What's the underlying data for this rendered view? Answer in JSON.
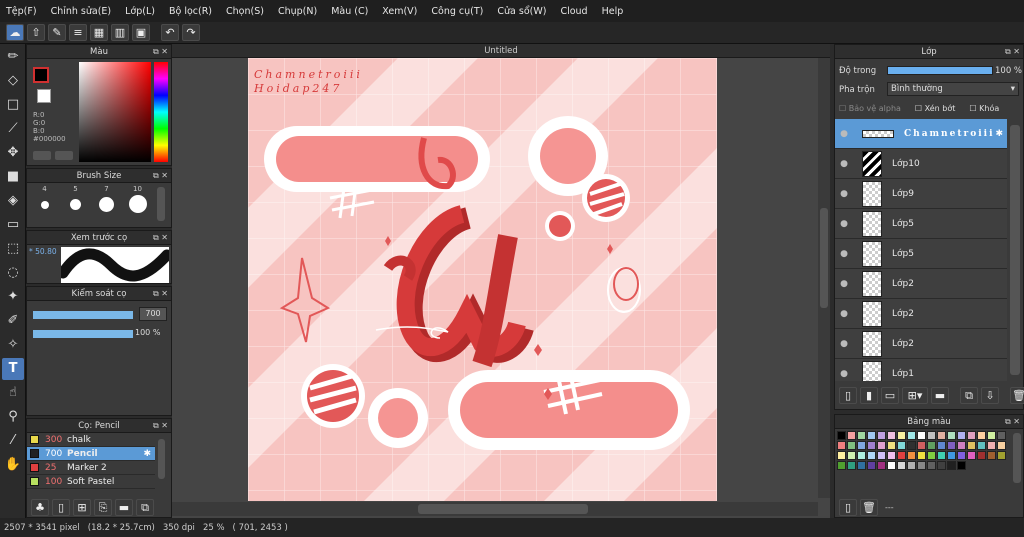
{
  "menu": [
    "Tệp(F)",
    "Chỉnh sửa(E)",
    "Lớp(L)",
    "Bộ lọc(R)",
    "Chọn(S)",
    "Chụp(N)",
    "Màu (C)",
    "Xem(V)",
    "Công cụ(T)",
    "Cửa sổ(W)",
    "Cloud",
    "Help"
  ],
  "document": {
    "title": "Untitled"
  },
  "color_panel": {
    "title": "Màu",
    "r": "R:0",
    "g": "G:0",
    "b": "B:0",
    "hex": "#000000"
  },
  "brush_size_panel": {
    "title": "Brush Size",
    "sizes": [
      "4",
      "5",
      "7",
      "10"
    ]
  },
  "preview_panel": {
    "title": "Xem trước cọ",
    "value": "50.80"
  },
  "control_panel": {
    "title": "Kiểm soát cọ",
    "size_value": "700",
    "opacity_value": "100 %",
    "size_fill": 1.0,
    "opacity_fill": 1.0
  },
  "brush_panel": {
    "title": "Cọ: Pencil",
    "items": [
      {
        "size": "300",
        "name": "chalk",
        "color": "#e8d84a"
      },
      {
        "size": "700",
        "name": "Pencil",
        "color": "#222222",
        "selected": true
      },
      {
        "size": "25",
        "name": "Marker 2",
        "color": "#e04040"
      },
      {
        "size": "100",
        "name": "Soft Pastel",
        "color": "#b8e060"
      }
    ]
  },
  "layer_panel": {
    "title": "Lớp",
    "opacity_label": "Độ trong",
    "opacity_value": "100 %",
    "blend_label": "Pha trộn",
    "blend_value": "Bình thường",
    "protect_alpha": "Bảo vệ alpha",
    "clipping": "Xén bớt",
    "lock": "Khóa",
    "layers": [
      {
        "name": "Chamnetroiii",
        "selected": true
      },
      {
        "name": "Lớp10"
      },
      {
        "name": "Lớp9"
      },
      {
        "name": "Lớp5"
      },
      {
        "name": "Lớp5"
      },
      {
        "name": "Lớp2"
      },
      {
        "name": "Lớp2"
      },
      {
        "name": "Lớp2"
      },
      {
        "name": "Lớp1"
      }
    ]
  },
  "palette_panel": {
    "title": "Bảng màu",
    "footer": "---"
  },
  "artwork": {
    "watermark_line1": "Chamnetroiii",
    "watermark_line2": "Hoidap247"
  },
  "status": {
    "size": "2507 * 3541 pixel",
    "cm": "(18.2 * 25.7cm)",
    "dpi": "350 dpi",
    "zoom": "25 %",
    "coords": "( 701, 2453 )"
  },
  "colors": {
    "accent": "#5b9ad6",
    "artboard": "#f7c4c1",
    "art_red": "#d63a3a"
  }
}
